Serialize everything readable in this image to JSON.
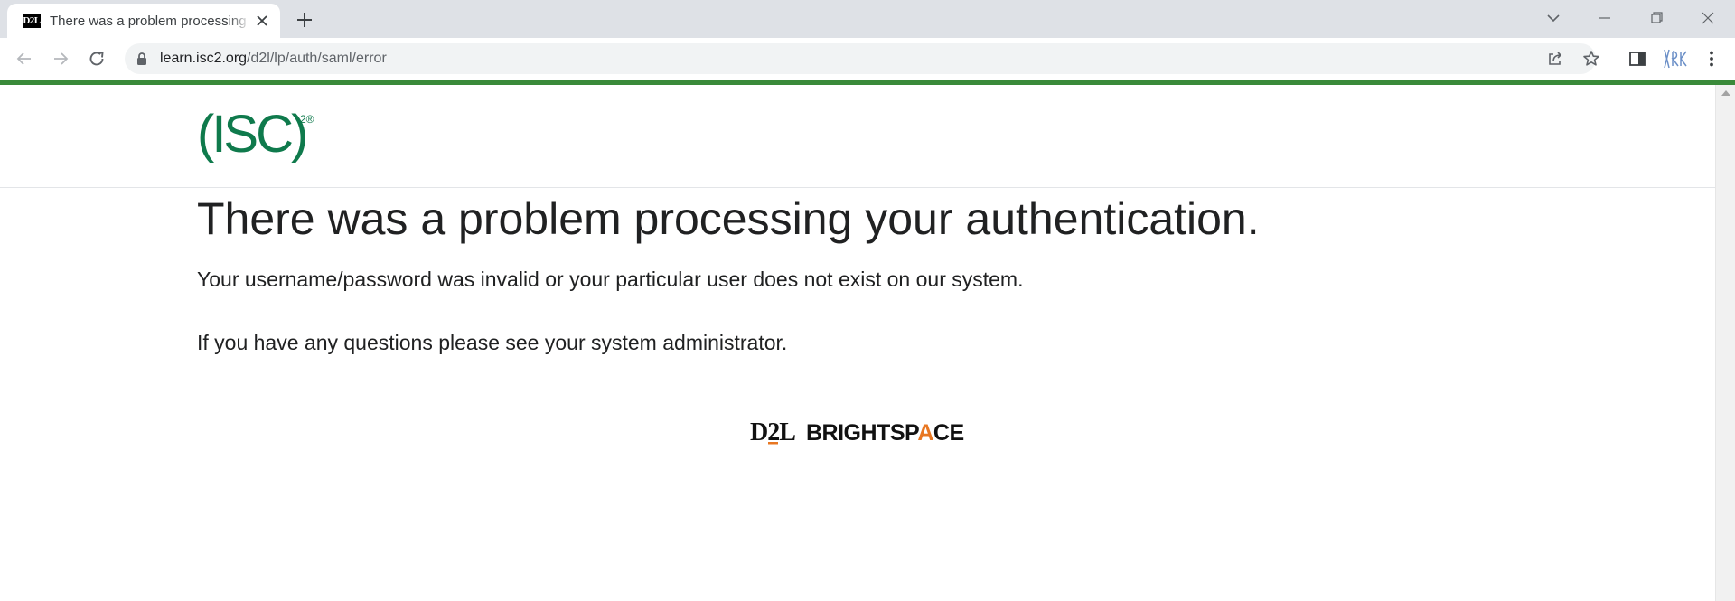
{
  "browser": {
    "tab": {
      "favicon_text": "D2L",
      "title": "There was a problem processing your authentication."
    },
    "address_bar": {
      "host": "learn.isc2.org",
      "path": "/d2l/lp/auth/saml/error"
    },
    "icons": {
      "back": "arrow-left-icon",
      "forward": "arrow-right-icon",
      "reload": "reload-icon",
      "lock": "lock-icon",
      "share": "share-icon",
      "bookmark": "star-icon",
      "side_panel": "side-panel-icon",
      "extension": "extension-icon",
      "menu": "kebab-menu-icon",
      "tab_search": "chevron-down-icon",
      "minimize": "minimize-icon",
      "restore": "restore-icon",
      "close": "close-icon"
    },
    "accent_color": "#3a8a3a"
  },
  "page": {
    "logo": {
      "text": "(ISC)",
      "superscript": "2®",
      "color": "#0f7a4c"
    },
    "title": "There was a problem processing your authentication.",
    "messages": [
      "Your username/password was invalid or your particular user does not exist on our system.",
      "If you have any questions please see your system administrator."
    ],
    "footer_logo": {
      "brand_prefix": "D2L",
      "brand_name_part1": "BRIGHTSP",
      "brand_name_accent": "A",
      "brand_name_part2": "CE",
      "accent_color": "#e87722"
    }
  }
}
